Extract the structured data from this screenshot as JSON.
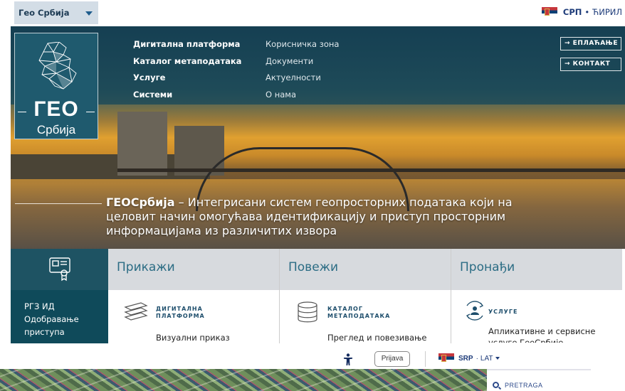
{
  "topbar": {
    "geo_select": "Гео Србија",
    "lang_active": "СРП",
    "lang_sep": "•",
    "lang_other": "ЋИРИЛ"
  },
  "logo": {
    "geo": "ГЕО",
    "srbija": "Србија"
  },
  "nav": {
    "primary": [
      "Дигитална платформа",
      "Каталог метаподатака",
      "Услуге",
      "Системи"
    ],
    "secondary": [
      "Корисничка зона",
      "Документи",
      "Актуелности",
      "О нама"
    ]
  },
  "side_buttons": {
    "pay": "→ ЕПЛАЋАЊЕ",
    "contact": "→ КОНТАКТ"
  },
  "hero": {
    "brand": "ГЕОСрбија",
    "text": " – Интегрисани систем геопросторних података који на целовит начин омогућава идентификацију и приступ просторним информацијама из различитих извора"
  },
  "id_panel": {
    "links": [
      "РГЗ ИД",
      "Одобравање",
      "приступа"
    ]
  },
  "columns": [
    {
      "head": "Прикажи",
      "title1": "ДИГИТАЛНА",
      "title2": "ПЛАТФОРМА",
      "desc": "Визуални приказ"
    },
    {
      "head": "Повежи",
      "title1": "КАТАЛОГ",
      "title2": "МЕТАПОДАТАКА",
      "desc": "Преглед и повезивање"
    },
    {
      "head": "Пронађи",
      "title1": "УСЛУГЕ",
      "title2": "",
      "desc": "Апликативне и сервисне услуге ГеоСрбије"
    }
  ],
  "bottom_bar": {
    "login": "Prijava",
    "lang_active": "SRP",
    "lang_sep": "·",
    "lang_other": "LAT"
  },
  "search": {
    "label": "PRETRAGA"
  },
  "colors": {
    "hero_dark": "#153f52",
    "accent_blue": "#2b6c84",
    "flag_red": "#c6363c",
    "flag_blue": "#0c4076"
  }
}
